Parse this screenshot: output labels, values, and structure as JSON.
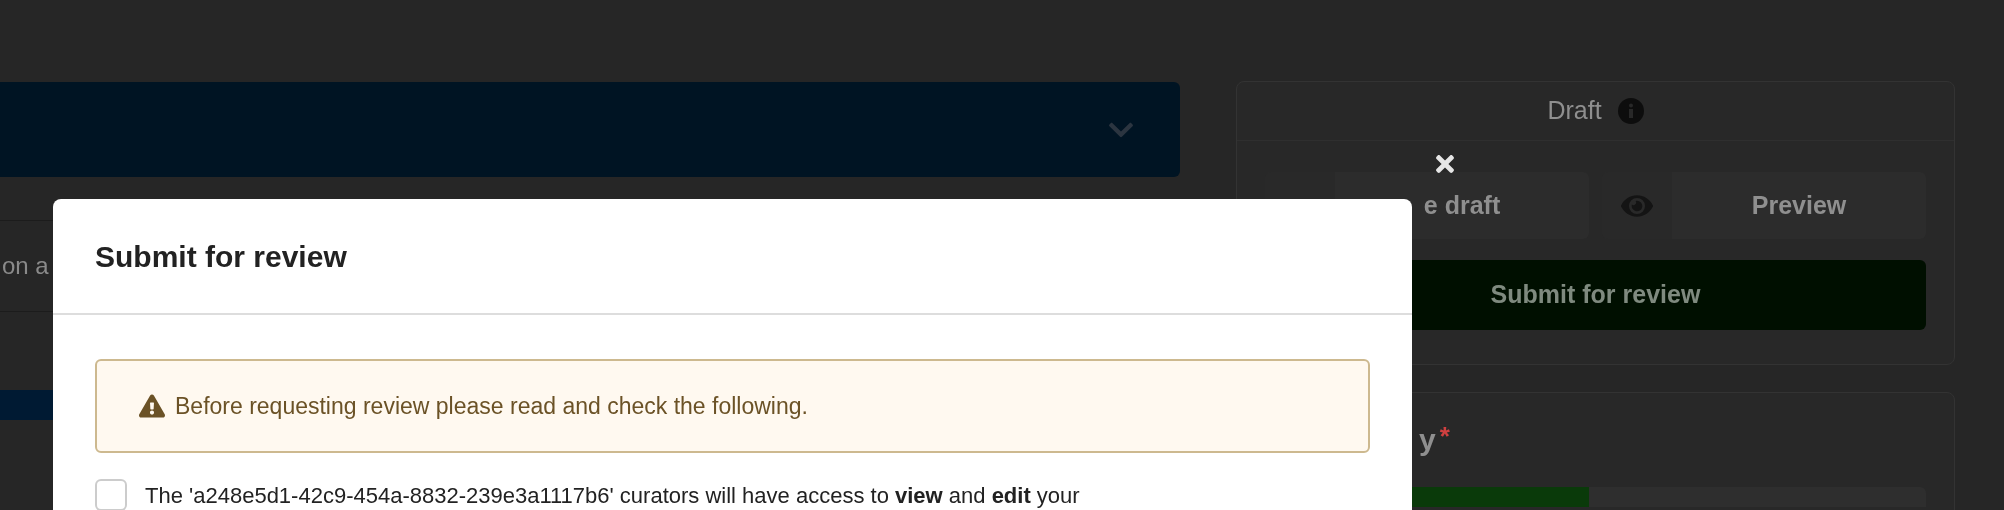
{
  "background": {
    "left_panel_text": "on a",
    "right_card": {
      "status": "Draft",
      "buttons": [
        {
          "kind": "save",
          "label": "e draft"
        },
        {
          "kind": "preview",
          "label": "Preview"
        }
      ],
      "submit": "Submit for review"
    },
    "lower_card": {
      "label": "y",
      "required_mark": "*",
      "progress": {
        "level": 0.49
      }
    }
  },
  "modal": {
    "title": "Submit for review",
    "alert": "Before requesting review please read and check the following.",
    "checklist": [
      {
        "text": "The 'a248e5d1-42c9-454a-8832-239e3a1117b6' curators will have access to **view** and **edit** your",
        "checked": false
      }
    ]
  }
}
